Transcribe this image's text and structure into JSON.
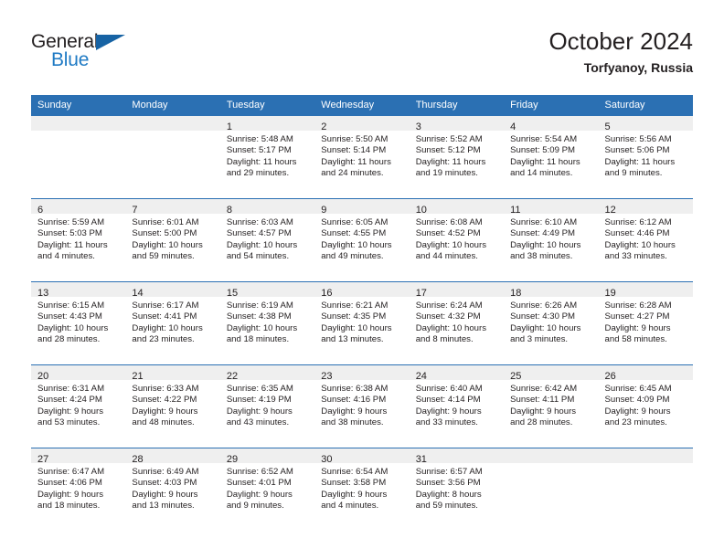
{
  "brand": {
    "name_top": "General",
    "name_bottom": "Blue",
    "triangle_color": "#1763a4",
    "blue_color": "#1f7ac4"
  },
  "header": {
    "title": "October 2024",
    "subtitle": "Torfyanoy, Russia"
  },
  "theme": {
    "header_bg": "#2b70b3",
    "header_text": "#ffffff",
    "daynum_band_bg": "#efefef",
    "text": "#231f20",
    "row_divider": "#2b70b3"
  },
  "weekday_headers": [
    "Sunday",
    "Monday",
    "Tuesday",
    "Wednesday",
    "Thursday",
    "Friday",
    "Saturday"
  ],
  "weeks": [
    [
      {
        "day": "",
        "sunrise": "",
        "sunset": "",
        "daylight_1": "",
        "daylight_2": ""
      },
      {
        "day": "",
        "sunrise": "",
        "sunset": "",
        "daylight_1": "",
        "daylight_2": ""
      },
      {
        "day": "1",
        "sunrise": "Sunrise: 5:48 AM",
        "sunset": "Sunset: 5:17 PM",
        "daylight_1": "Daylight: 11 hours",
        "daylight_2": "and 29 minutes."
      },
      {
        "day": "2",
        "sunrise": "Sunrise: 5:50 AM",
        "sunset": "Sunset: 5:14 PM",
        "daylight_1": "Daylight: 11 hours",
        "daylight_2": "and 24 minutes."
      },
      {
        "day": "3",
        "sunrise": "Sunrise: 5:52 AM",
        "sunset": "Sunset: 5:12 PM",
        "daylight_1": "Daylight: 11 hours",
        "daylight_2": "and 19 minutes."
      },
      {
        "day": "4",
        "sunrise": "Sunrise: 5:54 AM",
        "sunset": "Sunset: 5:09 PM",
        "daylight_1": "Daylight: 11 hours",
        "daylight_2": "and 14 minutes."
      },
      {
        "day": "5",
        "sunrise": "Sunrise: 5:56 AM",
        "sunset": "Sunset: 5:06 PM",
        "daylight_1": "Daylight: 11 hours",
        "daylight_2": "and 9 minutes."
      }
    ],
    [
      {
        "day": "6",
        "sunrise": "Sunrise: 5:59 AM",
        "sunset": "Sunset: 5:03 PM",
        "daylight_1": "Daylight: 11 hours",
        "daylight_2": "and 4 minutes."
      },
      {
        "day": "7",
        "sunrise": "Sunrise: 6:01 AM",
        "sunset": "Sunset: 5:00 PM",
        "daylight_1": "Daylight: 10 hours",
        "daylight_2": "and 59 minutes."
      },
      {
        "day": "8",
        "sunrise": "Sunrise: 6:03 AM",
        "sunset": "Sunset: 4:57 PM",
        "daylight_1": "Daylight: 10 hours",
        "daylight_2": "and 54 minutes."
      },
      {
        "day": "9",
        "sunrise": "Sunrise: 6:05 AM",
        "sunset": "Sunset: 4:55 PM",
        "daylight_1": "Daylight: 10 hours",
        "daylight_2": "and 49 minutes."
      },
      {
        "day": "10",
        "sunrise": "Sunrise: 6:08 AM",
        "sunset": "Sunset: 4:52 PM",
        "daylight_1": "Daylight: 10 hours",
        "daylight_2": "and 44 minutes."
      },
      {
        "day": "11",
        "sunrise": "Sunrise: 6:10 AM",
        "sunset": "Sunset: 4:49 PM",
        "daylight_1": "Daylight: 10 hours",
        "daylight_2": "and 38 minutes."
      },
      {
        "day": "12",
        "sunrise": "Sunrise: 6:12 AM",
        "sunset": "Sunset: 4:46 PM",
        "daylight_1": "Daylight: 10 hours",
        "daylight_2": "and 33 minutes."
      }
    ],
    [
      {
        "day": "13",
        "sunrise": "Sunrise: 6:15 AM",
        "sunset": "Sunset: 4:43 PM",
        "daylight_1": "Daylight: 10 hours",
        "daylight_2": "and 28 minutes."
      },
      {
        "day": "14",
        "sunrise": "Sunrise: 6:17 AM",
        "sunset": "Sunset: 4:41 PM",
        "daylight_1": "Daylight: 10 hours",
        "daylight_2": "and 23 minutes."
      },
      {
        "day": "15",
        "sunrise": "Sunrise: 6:19 AM",
        "sunset": "Sunset: 4:38 PM",
        "daylight_1": "Daylight: 10 hours",
        "daylight_2": "and 18 minutes."
      },
      {
        "day": "16",
        "sunrise": "Sunrise: 6:21 AM",
        "sunset": "Sunset: 4:35 PM",
        "daylight_1": "Daylight: 10 hours",
        "daylight_2": "and 13 minutes."
      },
      {
        "day": "17",
        "sunrise": "Sunrise: 6:24 AM",
        "sunset": "Sunset: 4:32 PM",
        "daylight_1": "Daylight: 10 hours",
        "daylight_2": "and 8 minutes."
      },
      {
        "day": "18",
        "sunrise": "Sunrise: 6:26 AM",
        "sunset": "Sunset: 4:30 PM",
        "daylight_1": "Daylight: 10 hours",
        "daylight_2": "and 3 minutes."
      },
      {
        "day": "19",
        "sunrise": "Sunrise: 6:28 AM",
        "sunset": "Sunset: 4:27 PM",
        "daylight_1": "Daylight: 9 hours",
        "daylight_2": "and 58 minutes."
      }
    ],
    [
      {
        "day": "20",
        "sunrise": "Sunrise: 6:31 AM",
        "sunset": "Sunset: 4:24 PM",
        "daylight_1": "Daylight: 9 hours",
        "daylight_2": "and 53 minutes."
      },
      {
        "day": "21",
        "sunrise": "Sunrise: 6:33 AM",
        "sunset": "Sunset: 4:22 PM",
        "daylight_1": "Daylight: 9 hours",
        "daylight_2": "and 48 minutes."
      },
      {
        "day": "22",
        "sunrise": "Sunrise: 6:35 AM",
        "sunset": "Sunset: 4:19 PM",
        "daylight_1": "Daylight: 9 hours",
        "daylight_2": "and 43 minutes."
      },
      {
        "day": "23",
        "sunrise": "Sunrise: 6:38 AM",
        "sunset": "Sunset: 4:16 PM",
        "daylight_1": "Daylight: 9 hours",
        "daylight_2": "and 38 minutes."
      },
      {
        "day": "24",
        "sunrise": "Sunrise: 6:40 AM",
        "sunset": "Sunset: 4:14 PM",
        "daylight_1": "Daylight: 9 hours",
        "daylight_2": "and 33 minutes."
      },
      {
        "day": "25",
        "sunrise": "Sunrise: 6:42 AM",
        "sunset": "Sunset: 4:11 PM",
        "daylight_1": "Daylight: 9 hours",
        "daylight_2": "and 28 minutes."
      },
      {
        "day": "26",
        "sunrise": "Sunrise: 6:45 AM",
        "sunset": "Sunset: 4:09 PM",
        "daylight_1": "Daylight: 9 hours",
        "daylight_2": "and 23 minutes."
      }
    ],
    [
      {
        "day": "27",
        "sunrise": "Sunrise: 6:47 AM",
        "sunset": "Sunset: 4:06 PM",
        "daylight_1": "Daylight: 9 hours",
        "daylight_2": "and 18 minutes."
      },
      {
        "day": "28",
        "sunrise": "Sunrise: 6:49 AM",
        "sunset": "Sunset: 4:03 PM",
        "daylight_1": "Daylight: 9 hours",
        "daylight_2": "and 13 minutes."
      },
      {
        "day": "29",
        "sunrise": "Sunrise: 6:52 AM",
        "sunset": "Sunset: 4:01 PM",
        "daylight_1": "Daylight: 9 hours",
        "daylight_2": "and 9 minutes."
      },
      {
        "day": "30",
        "sunrise": "Sunrise: 6:54 AM",
        "sunset": "Sunset: 3:58 PM",
        "daylight_1": "Daylight: 9 hours",
        "daylight_2": "and 4 minutes."
      },
      {
        "day": "31",
        "sunrise": "Sunrise: 6:57 AM",
        "sunset": "Sunset: 3:56 PM",
        "daylight_1": "Daylight: 8 hours",
        "daylight_2": "and 59 minutes."
      },
      {
        "day": "",
        "sunrise": "",
        "sunset": "",
        "daylight_1": "",
        "daylight_2": ""
      },
      {
        "day": "",
        "sunrise": "",
        "sunset": "",
        "daylight_1": "",
        "daylight_2": ""
      }
    ]
  ]
}
